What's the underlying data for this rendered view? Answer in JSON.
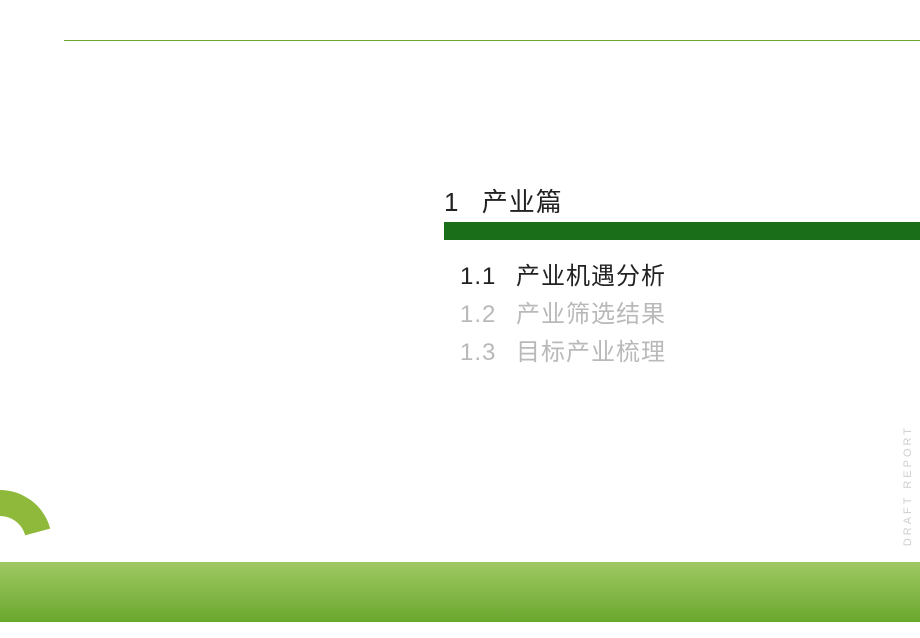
{
  "section": {
    "number": "1",
    "label": "产业篇"
  },
  "toc": [
    {
      "number": "1.1",
      "label": "产业机遇分析",
      "active": true
    },
    {
      "number": "1.2",
      "label": "产业筛选结果",
      "active": false
    },
    {
      "number": "1.3",
      "label": "目标产业梳理",
      "active": false
    }
  ],
  "watermark": "DRAFT  REPORT"
}
